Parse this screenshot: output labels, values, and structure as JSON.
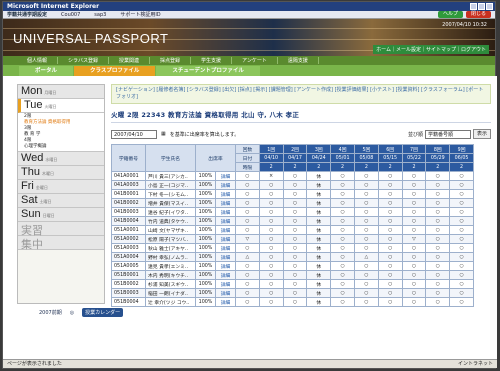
{
  "window": {
    "title": "Microsoft Internet Explorer"
  },
  "infobar": {
    "title": "学籍共通学期設定",
    "code1": "Cou007",
    "code2": "sap3",
    "support": "サポート検証用ID",
    "help": "ヘルプ",
    "logout": "閉じる"
  },
  "banner": {
    "logo": "UNIVERSAL PASSPORT",
    "stamp": "2007/04/10 10:32",
    "links": "ホーム｜メール設定｜サイトマップ｜ログアウト"
  },
  "gnav": [
    "個人情報",
    "シラバス登録",
    "授業関連",
    "採点登録",
    "学生支援",
    "アンケート",
    "遠隔支援"
  ],
  "tabs": [
    "ポータル",
    "クラスプロファイル",
    "スチューデントプロファイル"
  ],
  "sidebar": {
    "days": [
      {
        "name": "Mon",
        "note": "月曜日"
      },
      {
        "name": "Tue",
        "note": "火曜日"
      },
      {
        "name": "Wed",
        "note": "水曜日"
      },
      {
        "name": "Thu",
        "note": "木曜日"
      },
      {
        "name": "Fri",
        "note": "金曜日"
      },
      {
        "name": "Sat",
        "note": "土曜日"
      },
      {
        "name": "Sun",
        "note": "日曜日"
      },
      {
        "name": "実習",
        "note": ""
      },
      {
        "name": "集中",
        "note": ""
      }
    ],
    "tue_items": [
      "2限",
      "教育方法論 資格取得用",
      "3限",
      "教 育 学",
      "4限",
      "心理学概論"
    ],
    "term": "2007前期",
    "calendar": "授業カレンダー"
  },
  "funcbar": "[ナビゲーション] [履修者名簿] [シラバス登録] [出欠] [採点] [掲示] [課題管理] [アンケート作成] [授業評価結果] [小テスト] [授業資料] [クラスフォーラム] [ポートフォリオ]",
  "course": "火曜 2限 22343 教育方法論 資格取得用 北山 守, 八木 孝正",
  "controls": {
    "date": "2007/04/10",
    "date_note": "を基準に出席率を算出します。",
    "sort_label": "並び順",
    "sort_value": "学籍番号順",
    "sort_button": "表示"
  },
  "table": {
    "h_id": "学籍番号",
    "h_name": "学生氏名",
    "h_rate": "出席率",
    "h_session": "回数",
    "h_date": "日付",
    "h_period": "時限",
    "sessions": [
      "1回",
      "2回",
      "3回",
      "4回",
      "5回",
      "6回",
      "7回",
      "8回",
      "9回",
      "10回"
    ],
    "dates": [
      "04/10",
      "04/17",
      "04/24",
      "05/01",
      "05/08",
      "05/15",
      "05/22",
      "05/29",
      "06/05",
      "06/12"
    ],
    "periods": [
      "2",
      "2",
      "2",
      "2",
      "2",
      "2",
      "2",
      "2",
      "2",
      "2"
    ],
    "detail": "詳細",
    "rows": [
      {
        "id": "041A0001",
        "name": "芦川 貴三(アシカ..",
        "rate": "100%",
        "marks": [
          "○",
          "×",
          "○",
          "休",
          "○",
          "○",
          "○",
          "○",
          "○",
          "○"
        ]
      },
      {
        "id": "041A0003",
        "name": "小島 正一(コジマ..",
        "rate": "100%",
        "marks": [
          "○",
          "○",
          "○",
          "休",
          "○",
          "○",
          "○",
          "○",
          "○",
          "○"
        ]
      },
      {
        "id": "041B0001",
        "name": "下村 冬一(シモム..",
        "rate": "100%",
        "marks": [
          "○",
          "○",
          "○",
          "休",
          "○",
          "○",
          "○",
          "○",
          "○",
          "○"
        ]
      },
      {
        "id": "041B0002",
        "name": "増井 貴保(マスイ..",
        "rate": "100%",
        "marks": [
          "○",
          "○",
          "○",
          "休",
          "○",
          "○",
          "○",
          "○",
          "○",
          "○"
        ]
      },
      {
        "id": "041B0003",
        "name": "遠谷 紀子(イワタ..",
        "rate": "100%",
        "marks": [
          "○",
          "○",
          "○",
          "休",
          "○",
          "○",
          "○",
          "○",
          "○",
          "○"
        ]
      },
      {
        "id": "041B0004",
        "name": "竹内 道典(タケウ..",
        "rate": "100%",
        "marks": [
          "○",
          "○",
          "○",
          "休",
          "○",
          "○",
          "○",
          "○",
          "○",
          "○"
        ]
      },
      {
        "id": "051A0001",
        "name": "山崎 文(ヤマザキ..",
        "rate": "100%",
        "marks": [
          "○",
          "○",
          "○",
          "休",
          "○",
          "○",
          "○",
          "○",
          "○",
          "○"
        ]
      },
      {
        "id": "051A0002",
        "name": "松原 陽子(マツバ..",
        "rate": "100%",
        "marks": [
          "▽",
          "○",
          "○",
          "休",
          "○",
          "○",
          "○",
          "▽",
          "○",
          "○"
        ]
      },
      {
        "id": "051A0003",
        "name": "秋山 雅士(アキヤ..",
        "rate": "100%",
        "marks": [
          "○",
          "○",
          "○",
          "休",
          "○",
          "○",
          "○",
          "○",
          "○",
          "○"
        ]
      },
      {
        "id": "051A0004",
        "name": "野村 幸弘(ノムラ..",
        "rate": "100%",
        "marks": [
          "△",
          "○",
          "○",
          "休",
          "○",
          "△",
          "○",
          "○",
          "○",
          "○"
        ]
      },
      {
        "id": "051A0005",
        "name": "遠見 貴孝(エンミ..",
        "rate": "100%",
        "marks": [
          "○",
          "○",
          "○",
          "休",
          "○",
          "○",
          "○",
          "○",
          "○",
          "○"
        ]
      },
      {
        "id": "051B0001",
        "name": "木内 秀明(キウチ..",
        "rate": "100%",
        "marks": [
          "○",
          "○",
          "○",
          "休",
          "○",
          "○",
          "○",
          "○",
          "○",
          "○"
        ]
      },
      {
        "id": "051B0002",
        "name": "杉浦 知美(スギウ..",
        "rate": "100%",
        "marks": [
          "○",
          "○",
          "○",
          "休",
          "○",
          "○",
          "○",
          "○",
          "○",
          "○"
        ]
      },
      {
        "id": "051B0003",
        "name": "稲田 一朗(イナダ..",
        "rate": "100%",
        "marks": [
          "○",
          "○",
          "○",
          "休",
          "○",
          "○",
          "○",
          "○",
          "○",
          "○"
        ]
      },
      {
        "id": "051B0004",
        "name": "辻 幸介(ツジ コウ..",
        "rate": "100%",
        "marks": [
          "○",
          "○",
          "○",
          "休",
          "○",
          "○",
          "○",
          "○",
          "○",
          "○"
        ]
      }
    ]
  },
  "status": {
    "left": "ページが表示されました",
    "right": "イントラネット"
  }
}
